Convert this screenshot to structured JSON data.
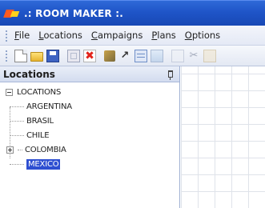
{
  "window": {
    "title": ".: ROOM MAKER :."
  },
  "menu": {
    "items": [
      {
        "first": "F",
        "rest": "ile"
      },
      {
        "first": "L",
        "rest": "ocations"
      },
      {
        "first": "C",
        "rest": "ampaigns"
      },
      {
        "first": "P",
        "rest": "lans"
      },
      {
        "first": "O",
        "rest": "ptions"
      }
    ]
  },
  "toolbar": {
    "icons": [
      "new-icon",
      "open-icon",
      "save-icon",
      "grid-icon",
      "delete-icon",
      "tools-icon",
      "cursor-icon",
      "table-icon",
      "image-icon",
      "copy-icon",
      "cut-icon",
      "paste-icon"
    ],
    "cursor_glyph": "↗",
    "delete_glyph": "✖",
    "cut_glyph": "✂"
  },
  "locations_panel": {
    "title": "Locations",
    "tree": {
      "root": "LOCATIONS",
      "children": [
        {
          "label": "ARGENTINA"
        },
        {
          "label": "BRASIL"
        },
        {
          "label": "CHILE"
        },
        {
          "label": "COLOMBIA"
        },
        {
          "label": "MEXICO",
          "selected": true
        }
      ]
    }
  },
  "colors": {
    "titlebar": "#1f55c8",
    "selection": "#2e4fd1"
  }
}
